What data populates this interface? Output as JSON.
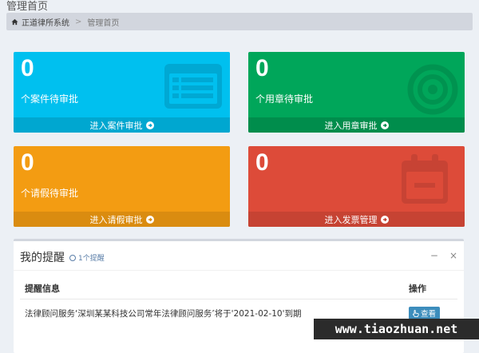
{
  "header": {
    "title": "管理首页"
  },
  "breadcrumb": {
    "home": "正道律所系统",
    "current": "管理首页",
    "separator": ">"
  },
  "boxes": [
    {
      "count": "0",
      "label": "个案件待审批",
      "link": "进入案件审批",
      "icon": "list-icon",
      "color": "#00c0ef"
    },
    {
      "count": "0",
      "label": "个用章待审批",
      "link": "进入用章审批",
      "icon": "target-icon",
      "color": "#00a65a"
    },
    {
      "count": "0",
      "label": "个请假待审批",
      "link": "进入请假审批",
      "icon": "none",
      "color": "#f39c12"
    },
    {
      "count": "0",
      "label": "",
      "link": "进入发票管理",
      "icon": "calendar-icon",
      "color": "#dd4b39"
    }
  ],
  "reminders": {
    "title": "我的提醒",
    "badge": "1个提醒",
    "tools": {
      "collapse": "−",
      "close": "×"
    },
    "columns": [
      "提醒信息",
      "操作"
    ],
    "rows": [
      {
        "message": "法律顾问服务‘深圳某某科技公司常年法律顾问服务’将于'2021-02-10'到期",
        "action": "查看"
      }
    ]
  },
  "watermark": "www.tiaozhuan.net"
}
